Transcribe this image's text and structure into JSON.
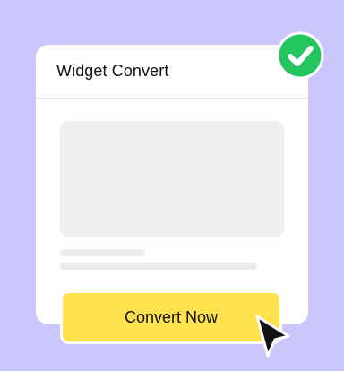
{
  "card": {
    "title": "Widget Convert"
  },
  "cta": {
    "label": "Convert Now"
  },
  "icons": {
    "badge": "check-circle-icon",
    "cursor": "pointer-cursor-icon"
  },
  "colors": {
    "background": "#cbc7fd",
    "card": "#ffffff",
    "placeholder": "#efefef",
    "button": "#ffe14d",
    "badge": "#22c55e"
  }
}
